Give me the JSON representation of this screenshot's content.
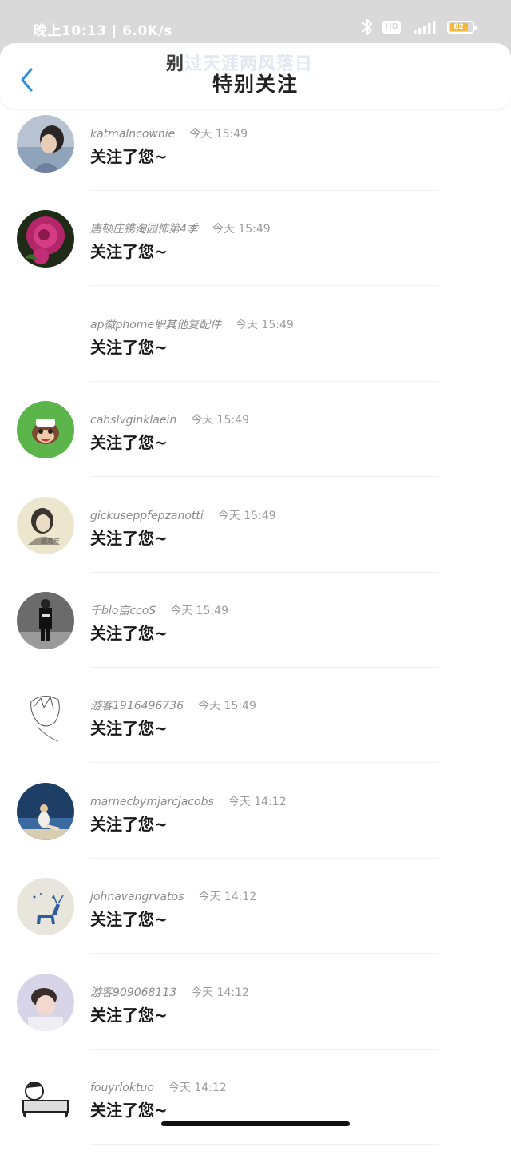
{
  "status_bar": {
    "left_text": "晚上10:13 | 6.0K/s",
    "hd_label": "HD",
    "battery_level": "82",
    "battery_fraction": 0.82,
    "icons": [
      "bluetooth-icon",
      "hd-icon",
      "signal-icon",
      "battery-icon"
    ]
  },
  "header": {
    "ghost_text_lead": "别",
    "ghost_text": "过天涯两风落日",
    "title": "特别关注",
    "back_icon": "chevron-left-icon",
    "accent_color": "#2a8fe0"
  },
  "items": [
    {
      "name": "katmalncownie",
      "time": "今天 15:49",
      "message": "关注了您~",
      "avatar": "portrait-blue-woman"
    },
    {
      "name": "唐顿庄镌淘园怖第4季",
      "time": "今天 15:49",
      "message": "关注了您~",
      "avatar": "pink-rose"
    },
    {
      "name": "ap徽phome职其他复配件",
      "time": "今天 15:49",
      "message": "关注了您~",
      "avatar": "none"
    },
    {
      "name": "cahslvginklaein",
      "time": "今天 15:49",
      "message": "关注了您~",
      "avatar": "monkey-face-green"
    },
    {
      "name": "gickuseppfepzanotti",
      "time": "今天 15:49",
      "message": "关注了您~",
      "avatar": "girl-sketch"
    },
    {
      "name": "千blo亩ccoS",
      "time": "今天 15:49",
      "message": "关注了您~",
      "avatar": "bw-street-man"
    },
    {
      "name": "游客1916496736",
      "time": "今天 15:49",
      "message": "关注了您~",
      "avatar": "anime-line-art"
    },
    {
      "name": "marnecbymjarcjacobs",
      "time": "今天 14:12",
      "message": "关注了您~",
      "avatar": "beach-sitting"
    },
    {
      "name": "johnavangrvatos",
      "time": "今天 14:12",
      "message": "关注了您~",
      "avatar": "blue-deer"
    },
    {
      "name": "游客909068113",
      "time": "今天 14:12",
      "message": "关注了您~",
      "avatar": "boy-pastel"
    },
    {
      "name": "fouyrloktuo",
      "time": "今天 14:12",
      "message": "关注了您~",
      "avatar": "cartoon-bed"
    }
  ]
}
